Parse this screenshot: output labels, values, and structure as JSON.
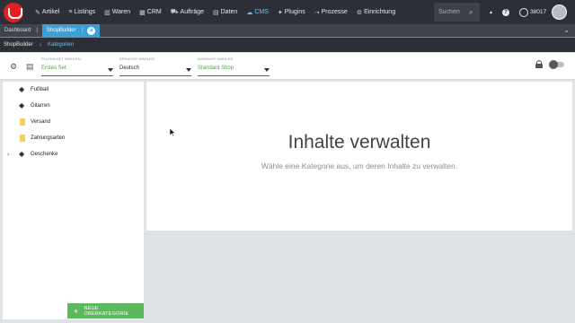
{
  "nav": {
    "items": [
      {
        "icon": "✎",
        "label": "Artikel"
      },
      {
        "icon": "≡",
        "label": "Listings"
      },
      {
        "icon": "▥",
        "label": "Waren"
      },
      {
        "icon": "▦",
        "label": "CRM"
      },
      {
        "icon": "⛟",
        "label": "Aufträge"
      },
      {
        "icon": "▤",
        "label": "Daten"
      },
      {
        "icon": "☁",
        "label": "CMS",
        "active": true
      },
      {
        "icon": "✦",
        "label": "Plugins"
      },
      {
        "icon": "⇢",
        "label": "Prozesse"
      },
      {
        "icon": "⚙",
        "label": "Einrichtung"
      }
    ],
    "search_placeholder": "Suchen",
    "bell_glyph": "🔔",
    "help_glyph": "?",
    "user_id": "38017"
  },
  "tabs": {
    "items": [
      {
        "label": "Dashboard",
        "active": false
      },
      {
        "label": "ShopBuilder",
        "active": true
      }
    ],
    "close_glyph": "×",
    "separator": "|",
    "expand_glyph": "⌄"
  },
  "breadcrumb": {
    "items": [
      "ShopBuilder",
      "Kategorien"
    ],
    "separator": "›"
  },
  "toolbar": {
    "selects": [
      {
        "label": "PLUGIN-SET WÄHLEN",
        "value": "Erstes Set",
        "highlight": true
      },
      {
        "label": "SPRACHE WÄHLEN",
        "value": "Deutsch",
        "highlight": false
      },
      {
        "label": "MANDANT WÄHLEN",
        "value": "Standard Shop",
        "highlight": true
      }
    ]
  },
  "categories": {
    "items": [
      {
        "label": "Fußball",
        "icon": "tag-icon",
        "expandable": false
      },
      {
        "label": "Gitarren",
        "icon": "tag-icon",
        "expandable": false
      },
      {
        "label": "Versand",
        "icon": "folder-icon",
        "expandable": false
      },
      {
        "label": "Zahlungsarten",
        "icon": "folder-icon",
        "expandable": false
      },
      {
        "label": "Geschenke",
        "icon": "tag-icon",
        "expandable": true
      }
    ],
    "add_button_label": "NEUE OBERKATEGORIE"
  },
  "content": {
    "title": "Inhalte verwalten",
    "subtitle": "Wähle eine Kategorie aus, um deren Inhalte zu verwalten."
  },
  "colors": {
    "topbar": "#2c3036",
    "accent": "#3d9fd4",
    "green": "#5cb85c",
    "logo": "#e31e24"
  }
}
